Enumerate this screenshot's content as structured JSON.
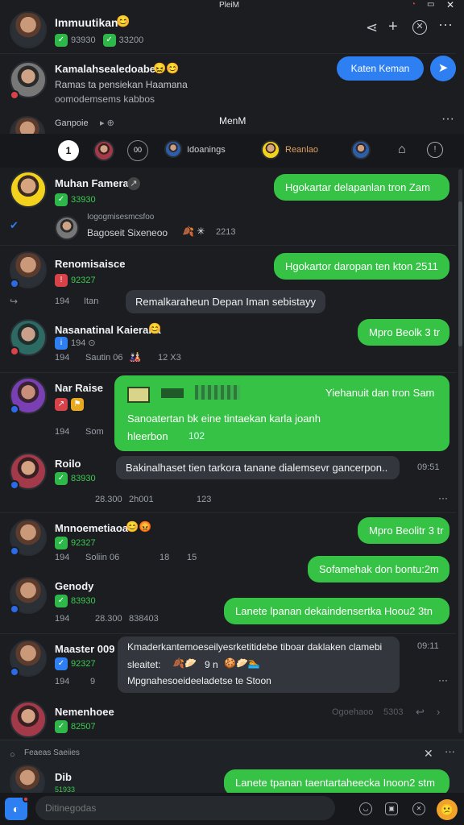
{
  "status_bar": {
    "title": "PleiM"
  },
  "header": {
    "name": "Immuutikan",
    "emoji": "😊",
    "sub_a": "93930",
    "sub_b": "33200"
  },
  "top_actions": [
    "share-icon",
    "plus-icon",
    "close-circle-icon",
    "more-icon"
  ],
  "pinned": {
    "name": "Kamalahsealedoabe:",
    "line1": "Ramas ta pensiekan Haamana",
    "line2": "oomodemsems kabbos",
    "button_label": "Katen Keman"
  },
  "group_header": {
    "name": "Ganpoie",
    "center_title": "MenM"
  },
  "filter_tabs": [
    {
      "label": ""
    },
    {
      "label": ""
    },
    {
      "label": "00"
    },
    {
      "label": "Idoanings"
    },
    {
      "label": "Reanlao"
    }
  ],
  "chats": [
    {
      "name": "Muhan Famerai",
      "sub": "33930",
      "bubble": "Hgokartar delapanlan tron Zam"
    },
    {
      "name": "Iogogmisesmcsfoo",
      "sub": "Bagoseit Sixeneoo",
      "meta": "2213"
    },
    {
      "name": "Renomisaisce",
      "sub": "92327",
      "bubble": "Hgokartor daropan ten kton 2511",
      "reply": "Remalkaraheun Depan Iman sebistayy",
      "meta_a": "194",
      "meta_b": "Itan"
    },
    {
      "name": "Nasanatinal Kaierana",
      "sub": "194",
      "bubble": "Mpro Beolk 3 tr",
      "meta_a": "194",
      "meta_b": "Sautin 06",
      "meta_c": "12 X3"
    },
    {
      "name": "Nar Raise",
      "sub": "194",
      "card_title": "Yiehanuit dan tron Sam",
      "card_body": "Sanoatertan bk eine tintaekan karla joanh",
      "card_body2": "hleerbon",
      "card_num": "102",
      "meta_a": "194",
      "meta_b": "Som"
    },
    {
      "name": "Roilo",
      "sub": "83930",
      "reply": "Bakinalhaset tien tarkora tanane dialemsevr gancerpon..",
      "meta_a": "28.300",
      "meta_b": "2h001",
      "meta_c": "123",
      "time": "09:51"
    },
    {
      "name": "Mnnoemetiaoa",
      "sub": "92327",
      "bubble": "Mpro Beolitr 3 tr",
      "meta_a": "194",
      "meta_b": "Soliin 06",
      "meta_c": "18",
      "meta_d": "15"
    },
    {
      "name": "Genody",
      "sub": "83930",
      "bubble": "Sofamehak don bontu:2m",
      "bubble2": "Lanete lpanan dekaindensertka Hoou2 3tn",
      "meta_a": "194",
      "meta_b": "28.300",
      "meta_c": "838403"
    },
    {
      "name": "Maaster 009",
      "sub": "92327",
      "reply1": "Kmaderkantemoeseilyesrketitidebe tiboar daklaken clamebi",
      "reply2": "sleaitet:",
      "reply2_b": "9 n",
      "reply3": "Mpgnahesoeideeladetse te Stoon",
      "meta_a": "194",
      "meta_b": "9",
      "time": "09:11"
    },
    {
      "name": "Nemenhoee",
      "sub": "82507",
      "meta_a": "Ogoehaoo",
      "meta_b": "5303"
    }
  ],
  "footer_chat": {
    "header": "Feaeas Saeiies",
    "name": "Dib",
    "sub": "51933",
    "bubble": "Lanete tpanan taentartaheecka Inoon2 stm"
  },
  "composer": {
    "placeholder": "Ditinegodas"
  }
}
